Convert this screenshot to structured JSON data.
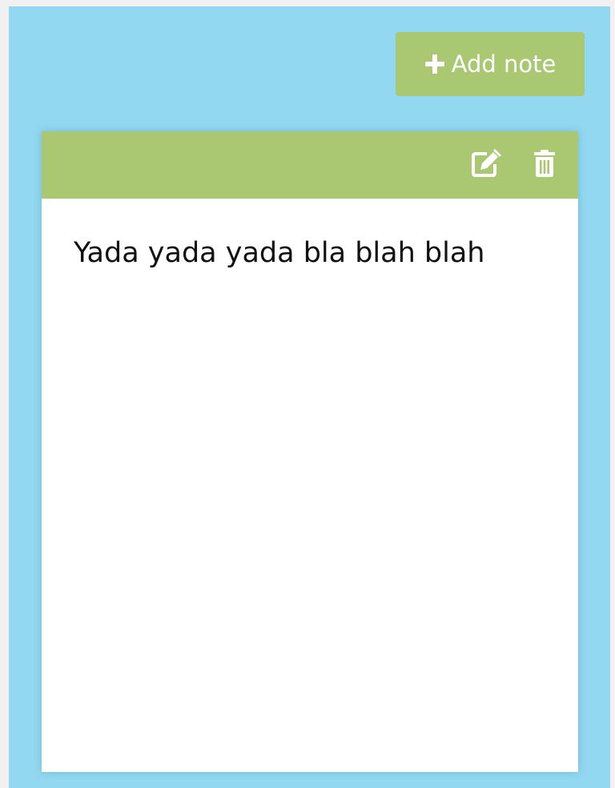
{
  "toolbar": {
    "add_note_label": "Add note",
    "add_icon": "plus-icon"
  },
  "note": {
    "header": {
      "edit_icon": "edit-icon",
      "delete_icon": "trash-icon"
    },
    "text": "Yada yada yada bla blah blah"
  },
  "colors": {
    "page_background": "#92d8f0",
    "accent_green": "#aac772",
    "card_background": "#ffffff",
    "text": "#111111"
  }
}
